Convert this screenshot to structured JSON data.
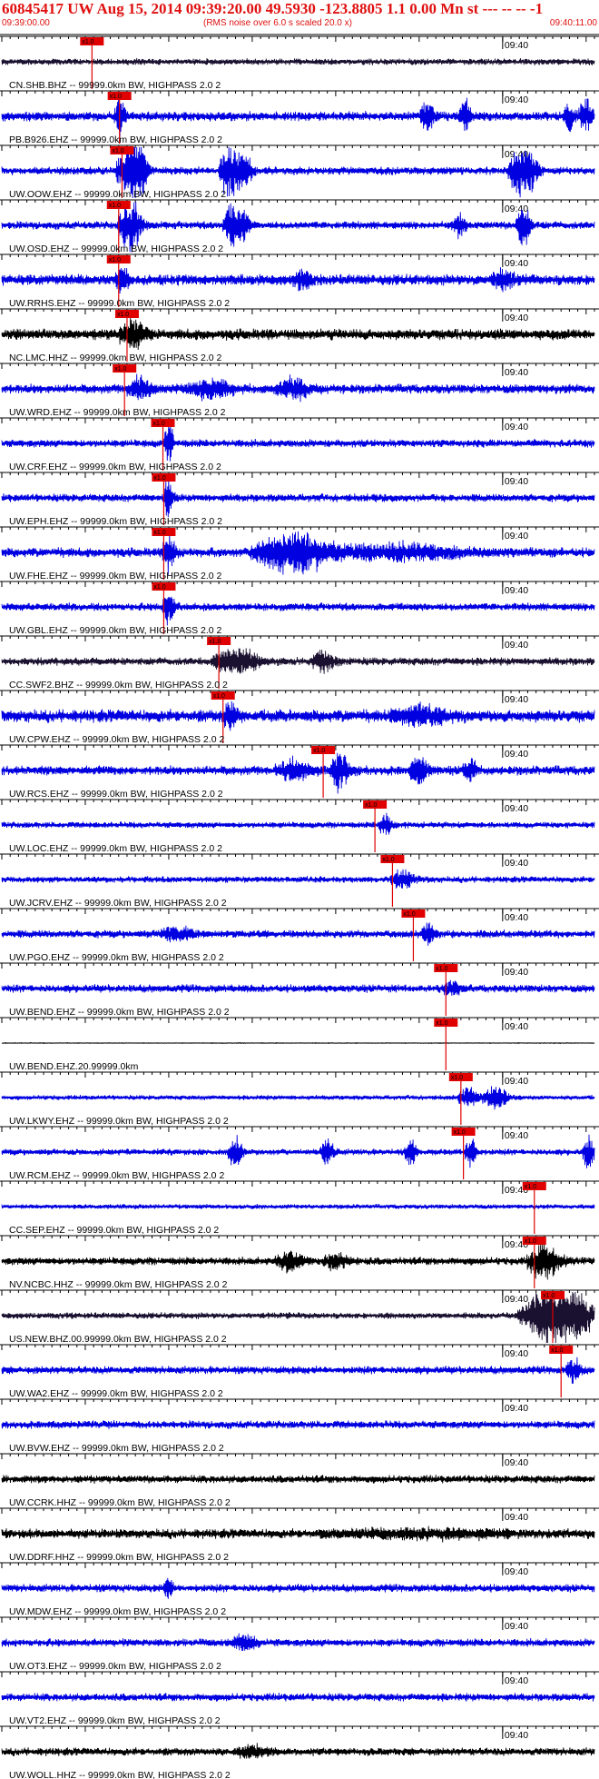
{
  "header": {
    "title": "60845417 UW Aug 15, 2014 09:39:20.00   49.5930 -123.8805  1.1 0.00 Mn st --- -- --  -1",
    "start_time": "09:39:00.00",
    "rms_note": "(RMS noise over 6.0 s scaled 20.0 x)",
    "end_time": "09:40:11.00"
  },
  "colors": {
    "header_text": "#e01010",
    "pick_marker": "#e00000",
    "blue_trace": "#0000e0",
    "dark_trace": "#1a1030",
    "black_trace": "#000000"
  },
  "chart_data": {
    "type": "line",
    "x_range_seconds": [
      0,
      71
    ],
    "tick_label": "09:40",
    "pick_label": "x1.0",
    "traces": [
      {
        "label": "CN.SHB.BHZ -- 99999.0km BW, HIGHPASS  2.0  2",
        "color": "#1a1030",
        "amp": 4,
        "pick_s": 10.8,
        "bursts": []
      },
      {
        "label": "PB.B926.EHZ -- 99999.0km BW, HIGHPASS  2.0  2",
        "color": "#0000e0",
        "amp": 6,
        "pick_s": 14.1,
        "bursts": [
          [
            14.2,
            0.5,
            20
          ],
          [
            51,
            0.6,
            18
          ],
          [
            55.5,
            0.5,
            20
          ],
          [
            68,
            0.5,
            16
          ],
          [
            70,
            0.6,
            20
          ]
        ]
      },
      {
        "label": "UW.OOW.EHZ -- 99999.0km BW, HIGHPASS  2.0  2",
        "color": "#0000e0",
        "amp": 5,
        "pick_s": 14.4,
        "bursts": [
          [
            15.2,
            1.0,
            38
          ],
          [
            16.5,
            0.7,
            28
          ],
          [
            27.3,
            0.9,
            36
          ],
          [
            29.2,
            0.6,
            24
          ],
          [
            62,
            0.9,
            30
          ],
          [
            63.5,
            0.6,
            20
          ]
        ]
      },
      {
        "label": "UW.OSD.EHZ -- 99999.0km BW, HIGHPASS  2.0  2",
        "color": "#0000e0",
        "amp": 5,
        "pick_s": 14.0,
        "bursts": [
          [
            15.4,
            1.0,
            34
          ],
          [
            27.5,
            0.7,
            28
          ],
          [
            29,
            0.5,
            20
          ],
          [
            54.8,
            0.6,
            12
          ],
          [
            62.5,
            0.6,
            28
          ]
        ]
      },
      {
        "label": "UW.RRHS.EHZ -- 99999.0km BW, HIGHPASS  2.0  2",
        "color": "#0000e0",
        "amp": 7,
        "pick_s": 14.0,
        "bursts": [
          [
            14.4,
            0.6,
            14
          ],
          [
            36,
            0.8,
            12
          ],
          [
            60,
            1.0,
            10
          ]
        ]
      },
      {
        "label": "NC.LMC.HHZ -- 99999.0km BW, HIGHPASS  2.0  2",
        "color": "#000000",
        "amp": 7,
        "pick_s": 15.0,
        "bursts": [
          [
            15.8,
            1.2,
            16
          ]
        ]
      },
      {
        "label": "UW.WRD.EHZ -- 99999.0km BW, HIGHPASS  2.0  2",
        "color": "#0000e0",
        "amp": 6,
        "pick_s": 14.7,
        "bursts": [
          [
            16.5,
            1.0,
            14
          ],
          [
            25,
            2.0,
            10
          ],
          [
            35,
            1.5,
            12
          ]
        ]
      },
      {
        "label": "UW.CRF.EHZ -- 99999.0km BW, HIGHPASS  2.0  2",
        "color": "#0000e0",
        "amp": 5,
        "pick_s": 19.3,
        "bursts": [
          [
            20,
            0.4,
            26
          ]
        ]
      },
      {
        "label": "UW.EPH.EHZ -- 99999.0km BW, HIGHPASS  2.0  2",
        "color": "#0000e0",
        "amp": 5,
        "pick_s": 19.4,
        "bursts": [
          [
            20,
            0.4,
            24
          ]
        ]
      },
      {
        "label": "UW.FHE.EHZ -- 99999.0km BW, HIGHPASS  2.0  2",
        "color": "#0000e0",
        "amp": 6,
        "pick_s": 19.4,
        "bursts": [
          [
            20,
            0.5,
            26
          ],
          [
            35,
            3.5,
            26
          ],
          [
            48,
            5.0,
            10
          ]
        ]
      },
      {
        "label": "UW.GBL.EHZ -- 99999.0km BW, HIGHPASS  2.0  2",
        "color": "#0000e0",
        "amp": 5,
        "pick_s": 19.4,
        "bursts": [
          [
            20,
            0.5,
            22
          ]
        ]
      },
      {
        "label": "CC.SWF2.BHZ -- 99999.0km BW, HIGHPASS  2.0  2",
        "color": "#1a1030",
        "amp": 5,
        "pick_s": 26.0,
        "bursts": [
          [
            28,
            2.0,
            16
          ],
          [
            38.5,
            1.0,
            12
          ]
        ]
      },
      {
        "label": "UW.CPW.EHZ -- 99999.0km BW, HIGHPASS  2.0  2",
        "color": "#0000e0",
        "amp": 8,
        "pick_s": 26.5,
        "bursts": [
          [
            27.4,
            0.6,
            18
          ],
          [
            50,
            2.5,
            10
          ]
        ]
      },
      {
        "label": "UW.RCS.EHZ -- 99999.0km BW, HIGHPASS  2.0  2",
        "color": "#0000e0",
        "amp": 6,
        "pick_s": 38.5,
        "bursts": [
          [
            40.5,
            0.8,
            22
          ],
          [
            35,
            1.5,
            12
          ],
          [
            50,
            0.8,
            18
          ],
          [
            56,
            0.6,
            14
          ]
        ]
      },
      {
        "label": "UW.LOC.EHZ -- 99999.0km BW, HIGHPASS  2.0  2",
        "color": "#0000e0",
        "amp": 4,
        "pick_s": 44.7,
        "bursts": [
          [
            46,
            0.6,
            14
          ]
        ]
      },
      {
        "label": "UW.JCRV.EHZ -- 99999.0km BW, HIGHPASS  2.0  2",
        "color": "#0000e0",
        "amp": 4,
        "pick_s": 46.8,
        "bursts": [
          [
            48,
            1.0,
            12
          ]
        ]
      },
      {
        "label": "UW.PGO.EHZ -- 99999.0km BW, HIGHPASS  2.0  2",
        "color": "#0000e0",
        "amp": 5,
        "pick_s": 49.3,
        "bursts": [
          [
            51,
            0.6,
            14
          ],
          [
            21,
            1.5,
            8
          ]
        ]
      },
      {
        "label": "UW.BEND.EHZ -- 99999.0km BW, HIGHPASS  2.0  2",
        "color": "#0000e0",
        "amp": 5,
        "pick_s": 53.2,
        "bursts": [
          [
            54,
            0.8,
            8
          ]
        ]
      },
      {
        "label": "UW.BEND.EHZ.20.99999.0km",
        "color": "#000000",
        "amp": 0.4,
        "pick_s": 53.2,
        "bursts": []
      },
      {
        "label": "UW.LKWY.EHZ -- 99999.0km BW, HIGHPASS  2.0  2",
        "color": "#0000e0",
        "amp": 3,
        "pick_s": 55.0,
        "bursts": [
          [
            56,
            0.9,
            12
          ],
          [
            59.2,
            1.1,
            16
          ]
        ]
      },
      {
        "label": "UW.RCM.EHZ -- 99999.0km BW, HIGHPASS  2.0  2",
        "color": "#0000e0",
        "amp": 4,
        "pick_s": 55.3,
        "bursts": [
          [
            56.2,
            0.5,
            20
          ],
          [
            28,
            0.6,
            20
          ],
          [
            39,
            0.6,
            16
          ],
          [
            49,
            0.5,
            16
          ],
          [
            70.3,
            0.5,
            20
          ]
        ]
      },
      {
        "label": "CC.SEP.EHZ -- 99999.0km BW, HIGHPASS  2.0  2",
        "color": "#0000e0",
        "amp": 3,
        "pick_s": 63.8,
        "bursts": []
      },
      {
        "label": "NV.NCBC.HHZ -- 99999.0km BW, HIGHPASS  2.0  2",
        "color": "#000000",
        "amp": 5,
        "pick_s": 63.8,
        "bursts": [
          [
            65,
            1.4,
            22
          ],
          [
            34.5,
            1.2,
            12
          ],
          [
            40,
            1.0,
            10
          ]
        ]
      },
      {
        "label": "US.NEW.BHZ.00.99999.0km BW, HIGHPASS  2.0  2",
        "color": "#1a1030",
        "amp": 4,
        "pick_s": 66.0,
        "bursts": [
          [
            67.5,
            2.5,
            38
          ],
          [
            64,
            1.5,
            22
          ]
        ]
      },
      {
        "label": "UW.WA2.EHZ -- 99999.0km BW, HIGHPASS  2.0  2",
        "color": "#0000e0",
        "amp": 5,
        "pick_s": 67.0,
        "bursts": [
          [
            68.5,
            0.6,
            14
          ]
        ]
      },
      {
        "label": "UW.BVW.EHZ -- 99999.0km BW, HIGHPASS  2.0  2",
        "color": "#0000e0",
        "amp": 5,
        "pick_s": null,
        "bursts": []
      },
      {
        "label": "UW.CCRK.HHZ -- 99999.0km BW, HIGHPASS  2.0  2",
        "color": "#000000",
        "amp": 5,
        "pick_s": null,
        "bursts": []
      },
      {
        "label": "UW.DDRF.HHZ -- 99999.0km BW, HIGHPASS  2.0  2",
        "color": "#000000",
        "amp": 6,
        "pick_s": null,
        "bursts": [
          [
            50,
            8.0,
            4
          ]
        ]
      },
      {
        "label": "UW.MDW.EHZ -- 99999.0km BW, HIGHPASS  2.0  2",
        "color": "#0000e0",
        "amp": 5,
        "pick_s": null,
        "bursts": [
          [
            20,
            0.4,
            12
          ]
        ]
      },
      {
        "label": "UW.OT3.EHZ -- 99999.0km BW, HIGHPASS  2.0  2",
        "color": "#0000e0",
        "amp": 5,
        "pick_s": null,
        "bursts": [
          [
            29,
            1.0,
            10
          ]
        ]
      },
      {
        "label": "UW.VT2.EHZ -- 99999.0km BW, HIGHPASS  2.0  2",
        "color": "#0000e0",
        "amp": 5,
        "pick_s": null,
        "bursts": []
      },
      {
        "label": "UW.WOLL.HHZ -- 99999.0km BW, HIGHPASS  2.0  2",
        "color": "#000000",
        "amp": 5,
        "pick_s": null,
        "bursts": [
          [
            30,
            1.5,
            6
          ]
        ]
      }
    ]
  }
}
